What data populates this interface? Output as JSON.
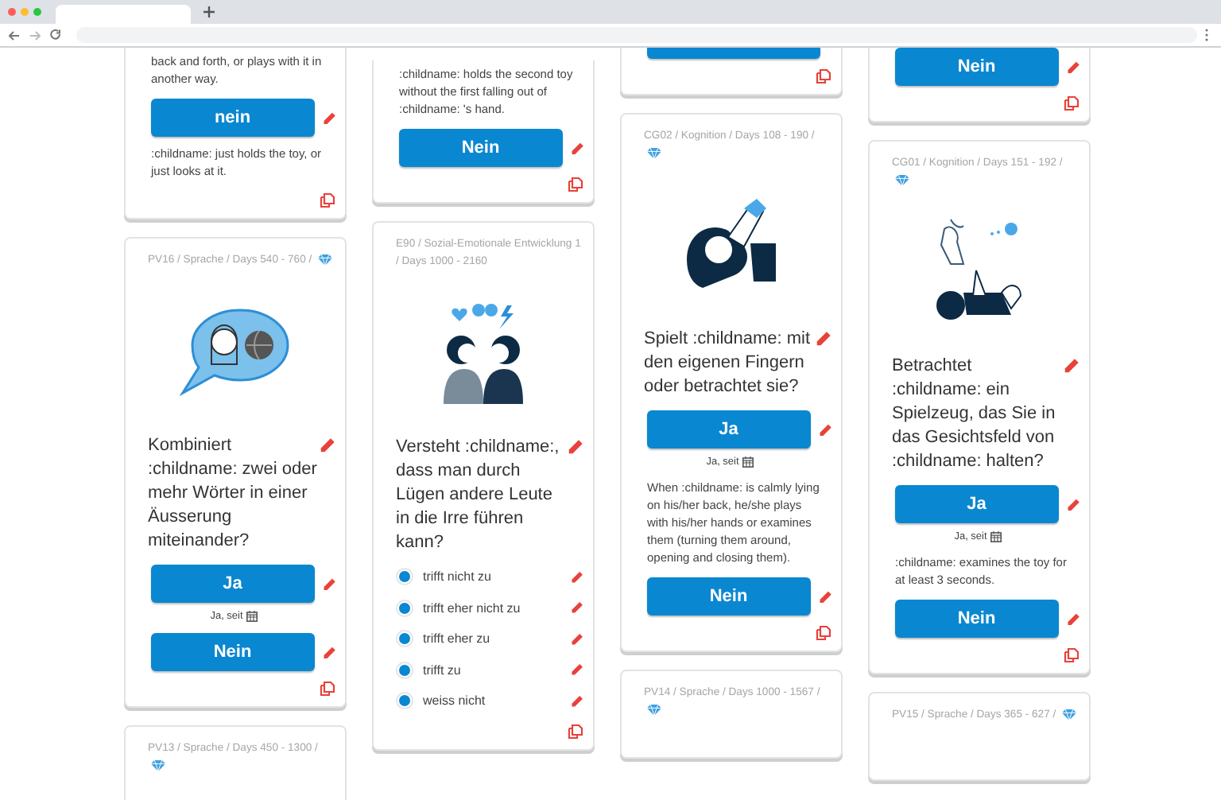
{
  "columns": [
    {
      "cards": [
        {
          "blocks": [
            {
              "kind": "note",
              "text": "back and forth, or plays with it in another way."
            },
            {
              "kind": "button",
              "label": "nein"
            },
            {
              "kind": "note",
              "text": ":childname: just holds the toy, or just looks at it."
            }
          ]
        },
        {
          "header": "PV16 / Sprache / Days 540 - 760  /",
          "gem": true,
          "blocks": [
            {
              "kind": "illustration"
            },
            {
              "kind": "question",
              "text": "Kombiniert :childname: zwei oder mehr Wörter in einer Äusserung miteinander?"
            },
            {
              "kind": "button",
              "label": "Ja"
            },
            {
              "kind": "since",
              "text": "Ja, seit"
            },
            {
              "kind": "button",
              "label": "Nein"
            }
          ]
        },
        {
          "header": "PV13 / Sprache / Days 450 - 1300  /",
          "gem": true
        }
      ]
    },
    {
      "cards": [
        {
          "blocks": [
            {
              "kind": "note",
              "text": ":childname: holds the second toy without the first falling out of :childname: 's hand."
            },
            {
              "kind": "button",
              "label": "Nein"
            }
          ]
        },
        {
          "header": "E90 / Sozial-Emotionale Entwicklung 1 / Days 1000 - 2160",
          "gem": false,
          "blocks": [
            {
              "kind": "illustration"
            },
            {
              "kind": "question",
              "text": "Versteht :childname:, dass man durch Lügen andere Leute in die Irre führen kann?"
            },
            {
              "kind": "option",
              "text": "trifft nicht zu",
              "selected": false
            },
            {
              "kind": "option",
              "text": "trifft eher nicht zu",
              "selected": false
            },
            {
              "kind": "option",
              "text": "trifft eher zu",
              "selected": false
            },
            {
              "kind": "option",
              "text": "trifft zu",
              "selected": false
            },
            {
              "kind": "option",
              "text": "weiss nicht",
              "selected": false
            }
          ]
        }
      ]
    },
    {
      "cards": [
        {
          "blocks": [
            {
              "kind": "button"
            }
          ]
        },
        {
          "header": "CG02 / Kognition / Days 108 - 190  /",
          "gem": true,
          "blocks": [
            {
              "kind": "illustration"
            },
            {
              "kind": "question",
              "text": "Spielt :childname: mit den eigenen Fingern oder betrachtet sie?"
            },
            {
              "kind": "button",
              "label": "Ja"
            },
            {
              "kind": "since",
              "text": "Ja, seit"
            },
            {
              "kind": "note",
              "text": "When :childname: is calmly lying on his/her back, he/she plays with his/her hands or examines them (turning them around, opening and closing them)."
            },
            {
              "kind": "button",
              "label": "Nein"
            }
          ]
        },
        {
          "header": "PV14 / Sprache / Days 1000 - 1567  /",
          "gem": true
        }
      ]
    },
    {
      "cards": [
        {
          "blocks": [
            {
              "kind": "button",
              "label": "Nein"
            }
          ]
        },
        {
          "header": "CG01 / Kognition / Days 151 - 192  /",
          "gem": true,
          "blocks": [
            {
              "kind": "illustration"
            },
            {
              "kind": "question",
              "text": "Betrachtet :childname: ein Spielzeug, das Sie in das Gesichtsfeld von :childname: halten?"
            },
            {
              "kind": "button",
              "label": "Ja"
            },
            {
              "kind": "since",
              "text": "Ja, seit"
            },
            {
              "kind": "note",
              "text": ":childname: examines the toy for at least 3 seconds."
            },
            {
              "kind": "button",
              "label": "Nein"
            }
          ]
        },
        {
          "header": "PV15 / Sprache / Days 365 - 627  /",
          "gem": true
        }
      ]
    }
  ]
}
